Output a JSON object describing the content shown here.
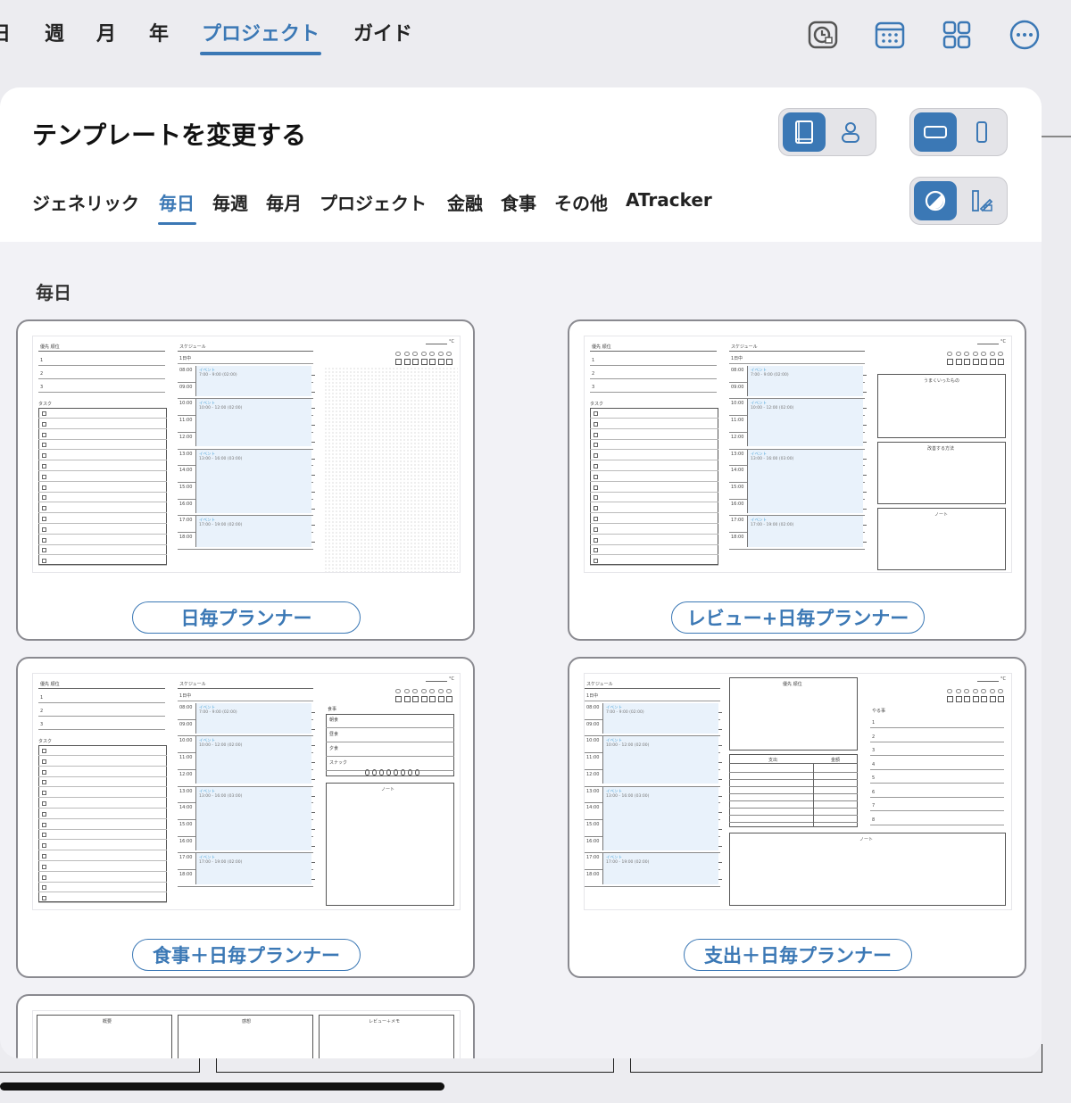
{
  "top_nav": {
    "items": [
      {
        "label": "日"
      },
      {
        "label": "週"
      },
      {
        "label": "月"
      },
      {
        "label": "年"
      },
      {
        "label": "プロジェクト",
        "active": true
      },
      {
        "label": "ガイド"
      }
    ],
    "icons": [
      "timer-icon",
      "calendar-icon",
      "grid-icon",
      "more-icon"
    ]
  },
  "sheet": {
    "title": "テンプレートを変更する",
    "tabs": [
      {
        "label": "ジェネリック"
      },
      {
        "label": "毎日",
        "active": true
      },
      {
        "label": "毎週"
      },
      {
        "label": "毎月"
      },
      {
        "label": "プロジェクト"
      },
      {
        "label": "金融"
      },
      {
        "label": "食事"
      },
      {
        "label": "その他"
      },
      {
        "label": "ATracker"
      }
    ],
    "section_title": "毎日",
    "templates": [
      {
        "name": "日毎プランナー"
      },
      {
        "name": "レビュー+日毎プランナー"
      },
      {
        "name": "食事＋日毎プランナー"
      },
      {
        "name": "支出＋日毎プランナー"
      }
    ]
  },
  "thumb_text": {
    "priority": "優先 順位",
    "schedule": "スケジュール",
    "tasks": "タスク",
    "todo": "やる事",
    "allday": "1日中",
    "event": "イベント",
    "temp": "°C",
    "went_well": "うまくいったもの",
    "improve": "改善する方法",
    "note": "ノート",
    "meal": "食事",
    "breakfast": "朝食",
    "lunch": "昼食",
    "dinner": "夕食",
    "snack": "スナック",
    "expense": "支出",
    "amount": "金額",
    "summary": "概要",
    "impression": "感想",
    "review_memo": "レビュー＋メモ",
    "times": [
      "08:00",
      "09:00",
      "10:00",
      "11:00",
      "12:00",
      "13:00",
      "14:00",
      "15:00",
      "16:00",
      "17:00",
      "18:00"
    ],
    "ev_ranges": [
      "7:00 - 9:00 (02:00)",
      "10:00 - 12:00 (02:00)",
      "13:00 - 16:00 (03:00)",
      "17:00 - 19:00 (02:00)"
    ],
    "nums": [
      "1",
      "2",
      "3",
      "4",
      "5",
      "6",
      "7",
      "8"
    ]
  }
}
